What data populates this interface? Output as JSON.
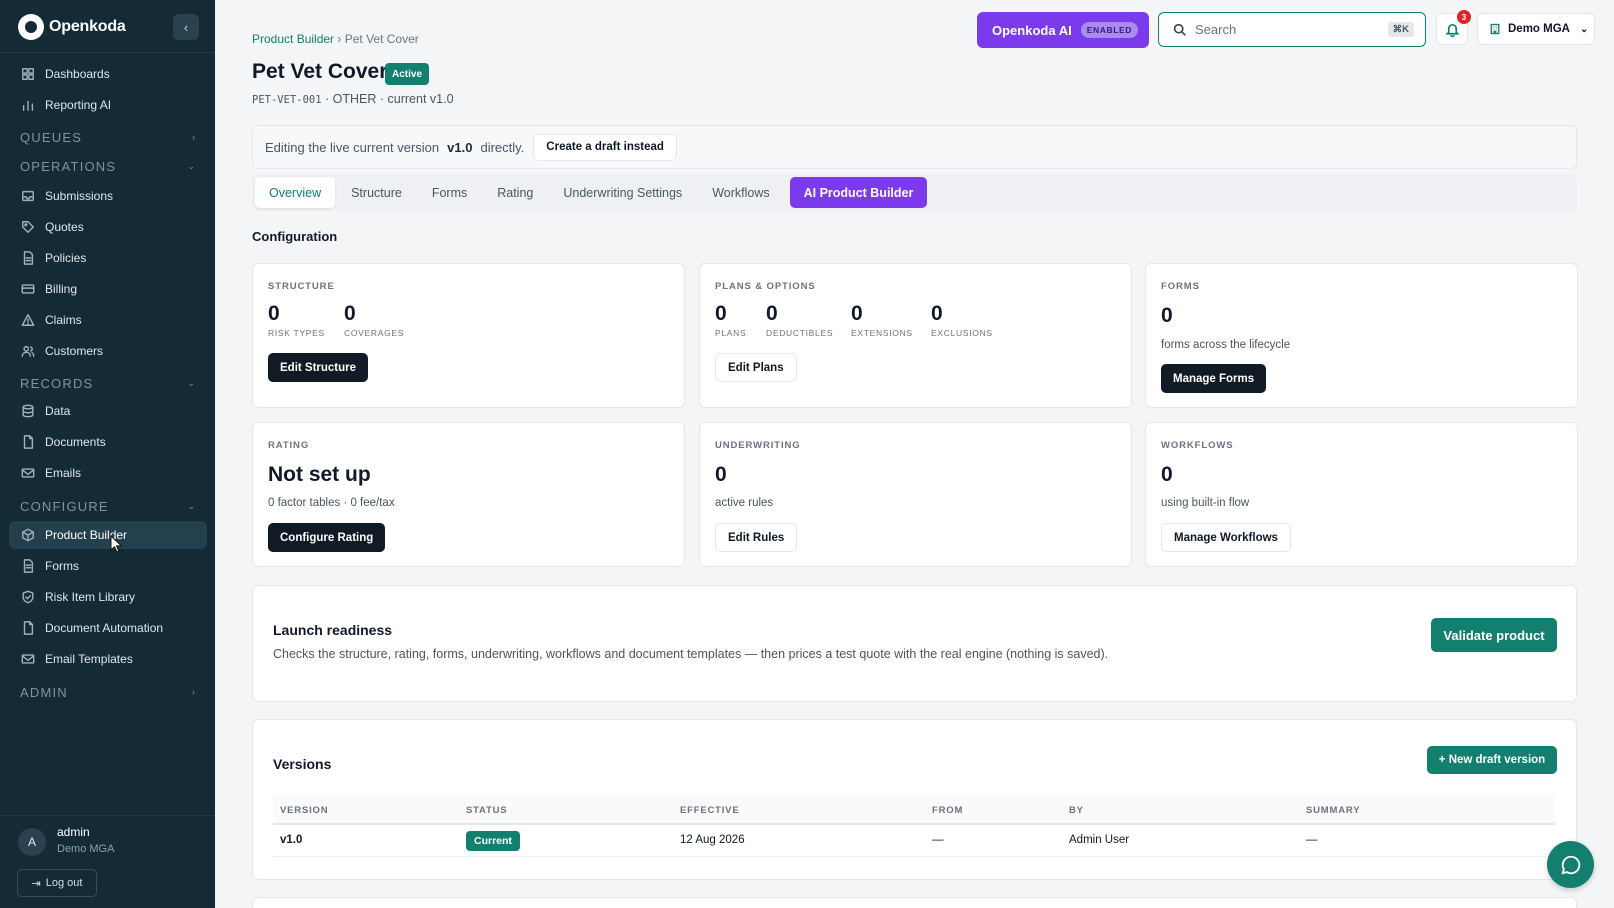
{
  "app": {
    "name": "Openkoda"
  },
  "sidebar": {
    "top_items": [
      {
        "label": "Dashboards",
        "icon": "grid-icon"
      },
      {
        "label": "Reporting AI",
        "icon": "bar-chart-icon"
      }
    ],
    "sections": {
      "queues": "QUEUES",
      "operations": "OPERATIONS",
      "records": "RECORDS",
      "configure": "CONFIGURE",
      "admin": "ADMIN"
    },
    "operations_items": [
      {
        "label": "Submissions",
        "icon": "inbox-icon"
      },
      {
        "label": "Quotes",
        "icon": "tag-icon"
      },
      {
        "label": "Policies",
        "icon": "file-icon"
      },
      {
        "label": "Billing",
        "icon": "credit-card-icon"
      },
      {
        "label": "Claims",
        "icon": "alert-triangle-icon"
      },
      {
        "label": "Customers",
        "icon": "users-icon"
      }
    ],
    "records_items": [
      {
        "label": "Data",
        "icon": "database-icon"
      },
      {
        "label": "Documents",
        "icon": "document-icon"
      },
      {
        "label": "Emails",
        "icon": "mail-icon"
      }
    ],
    "configure_items": [
      {
        "label": "Product Builder",
        "icon": "box-icon",
        "active": true
      },
      {
        "label": "Forms",
        "icon": "form-icon"
      },
      {
        "label": "Risk Item Library",
        "icon": "shield-icon"
      },
      {
        "label": "Document Automation",
        "icon": "document-icon"
      },
      {
        "label": "Email Templates",
        "icon": "mail-icon"
      }
    ],
    "user": {
      "initial": "A",
      "name": "admin",
      "org": "Demo MGA"
    },
    "logout_label": "Log out"
  },
  "header": {
    "breadcrumb_root": "Product Builder",
    "breadcrumb_separator": "›",
    "breadcrumb_current": "Pet Vet Cover",
    "title": "Pet Vet Cover",
    "status_badge": "Active",
    "code": "PET-VET-001",
    "meta": "· OTHER · current v1.0",
    "ai_button": "Openkoda AI",
    "ai_status": "ENABLED",
    "search_placeholder": "Search",
    "search_shortcut": "⌘K",
    "notification_count": "3",
    "org_label": "Demo MGA"
  },
  "banner": {
    "prefix": "Editing the live current version",
    "version": "v1.0",
    "suffix": "directly.",
    "button": "Create a draft instead"
  },
  "tabs": [
    "Overview",
    "Structure",
    "Forms",
    "Rating",
    "Underwriting Settings",
    "Workflows",
    "AI Product Builder"
  ],
  "configuration": {
    "title": "Configuration",
    "structure": {
      "label": "STRUCTURE",
      "metrics": [
        {
          "value": "0",
          "label": "RISK TYPES"
        },
        {
          "value": "0",
          "label": "COVERAGES"
        }
      ],
      "button": "Edit Structure"
    },
    "plans": {
      "label": "PLANS & OPTIONS",
      "metrics": [
        {
          "value": "0",
          "label": "PLANS"
        },
        {
          "value": "0",
          "label": "DEDUCTIBLES"
        },
        {
          "value": "0",
          "label": "EXTENSIONS"
        },
        {
          "value": "0",
          "label": "EXCLUSIONS"
        }
      ],
      "button": "Edit Plans"
    },
    "forms": {
      "label": "FORMS",
      "value": "0",
      "desc": "forms across the lifecycle",
      "button": "Manage Forms"
    },
    "rating": {
      "label": "RATING",
      "value": "Not set up",
      "desc": "0 factor tables · 0 fee/tax",
      "button": "Configure Rating"
    },
    "underwriting": {
      "label": "UNDERWRITING",
      "value": "0",
      "desc": "active rules",
      "button": "Edit Rules"
    },
    "workflows": {
      "label": "WORKFLOWS",
      "value": "0",
      "desc": "using built-in flow",
      "button": "Manage Workflows"
    }
  },
  "launch": {
    "title": "Launch readiness",
    "desc": "Checks the structure, rating, forms, underwriting, workflows and document templates — then prices a test quote with the real engine (nothing is saved).",
    "button": "Validate product"
  },
  "versions": {
    "title": "Versions",
    "new_button": "+ New draft version",
    "columns": [
      "VERSION",
      "STATUS",
      "EFFECTIVE",
      "FROM",
      "BY",
      "SUMMARY"
    ],
    "rows": [
      {
        "version": "v1.0",
        "status": "Current",
        "effective": "12 Aug 2026",
        "from": "—",
        "by": "Admin User",
        "summary": "—"
      }
    ]
  },
  "colors": {
    "sidebar_bg": "#142b36",
    "accent_teal": "#13806f",
    "ai_purple": "#7c3aed",
    "badge_red": "#dc2626"
  }
}
